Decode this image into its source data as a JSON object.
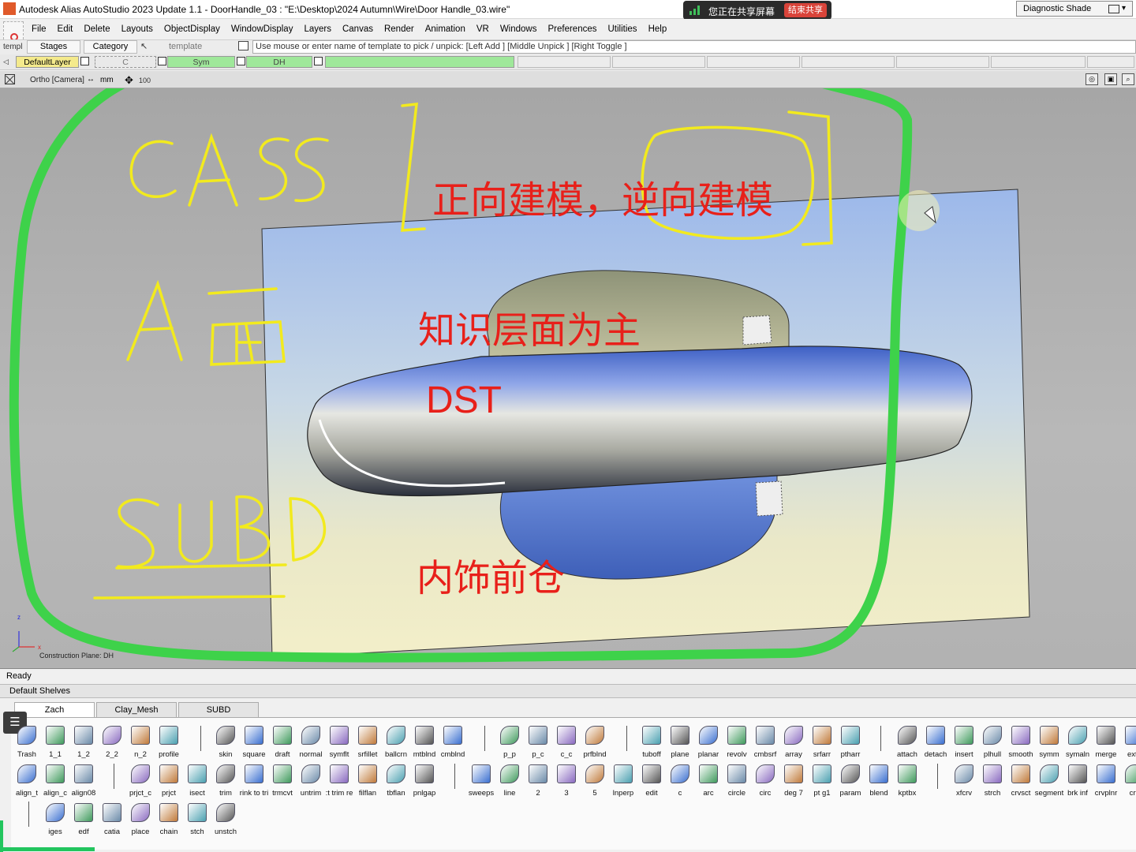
{
  "window": {
    "title": "Autodesk Alias AutoStudio 2023 Update 1.1     - DoorHandle_03 : \"E:\\Desktop\\2024 Autumn\\Wire\\Door Handle_03.wire\"",
    "share_status": "您正在共享屏幕",
    "share_stop": "结束共享",
    "shade_mode": "Diagnostic Shade",
    "accent_green": "#22c55e"
  },
  "menu": [
    "File",
    "Edit",
    "Delete",
    "Layouts",
    "ObjectDisplay",
    "WindowDisplay",
    "Layers",
    "Canvas",
    "Render",
    "Animation",
    "VR",
    "Windows",
    "Preferences",
    "Utilities",
    "Help"
  ],
  "toolbar2": {
    "templ_label": "templ",
    "stages": "Stages",
    "category": "Category",
    "template_placeholder": "template",
    "prompt": "Use mouse or enter name of template to pick / unpick: [Left Add ] [Middle Unpick ] [Right Toggle ]"
  },
  "layers": {
    "default": "DefaultLayer",
    "c": "C",
    "sym": "Sym",
    "dh": "DH"
  },
  "viewport": {
    "title": "Ortho [Camera]",
    "unit": "mm",
    "zoom": "100",
    "axis_z": "z",
    "axis_x": "x",
    "construction_plane": "Construction Plane: DH"
  },
  "annotations": {
    "handwritten": [
      "CAS",
      "A面",
      "SUBD"
    ],
    "forward_reverse": "正向建模，逆向建模",
    "knowledge": "知识层面为主",
    "dst": "DST",
    "interior": "内饰前仓"
  },
  "status": "Ready",
  "shelves": {
    "title": "Default Shelves",
    "tabs": [
      "Zach",
      "Clay_Mesh",
      "SUBD"
    ],
    "row1": [
      "Trash",
      "1_1",
      "1_2",
      "2_2",
      "n_2",
      "profile",
      "skin",
      "square",
      "draft",
      "normal",
      "symflt",
      "srfillet",
      "ballcrn",
      "mtblnd",
      "cmblnd",
      "p_p",
      "p_c",
      "c_c",
      "prfblnd",
      "tuboff",
      "plane",
      "planar",
      "revolv",
      "cmbsrf",
      "array",
      "srfarr",
      "ptharr",
      "attach",
      "detach",
      "insert",
      "plhull",
      "smooth",
      "symm",
      "symaln",
      "merge",
      "exte"
    ],
    "row2": [
      "align_t",
      "align_c",
      "align08",
      "prjct_c",
      "prjct",
      "isect",
      "trim",
      "rink to tri",
      "trmcvt",
      "untrim",
      ":t trim re",
      "filflan",
      "tbflan",
      "pnlgap",
      "sweeps",
      "line",
      "2",
      "3",
      "5",
      "lnperp",
      "edit",
      "c",
      "arc",
      "circle",
      "circ",
      "deg 7",
      "pt g1",
      "param",
      "blend",
      "kptbx",
      "xfcrv",
      "strch",
      "crvsct",
      "segment",
      "brk inf",
      "crvplnr",
      "crv"
    ],
    "row3": [
      "iges",
      "edf",
      "catia",
      "place",
      "chain",
      "stch",
      "unstch"
    ]
  }
}
